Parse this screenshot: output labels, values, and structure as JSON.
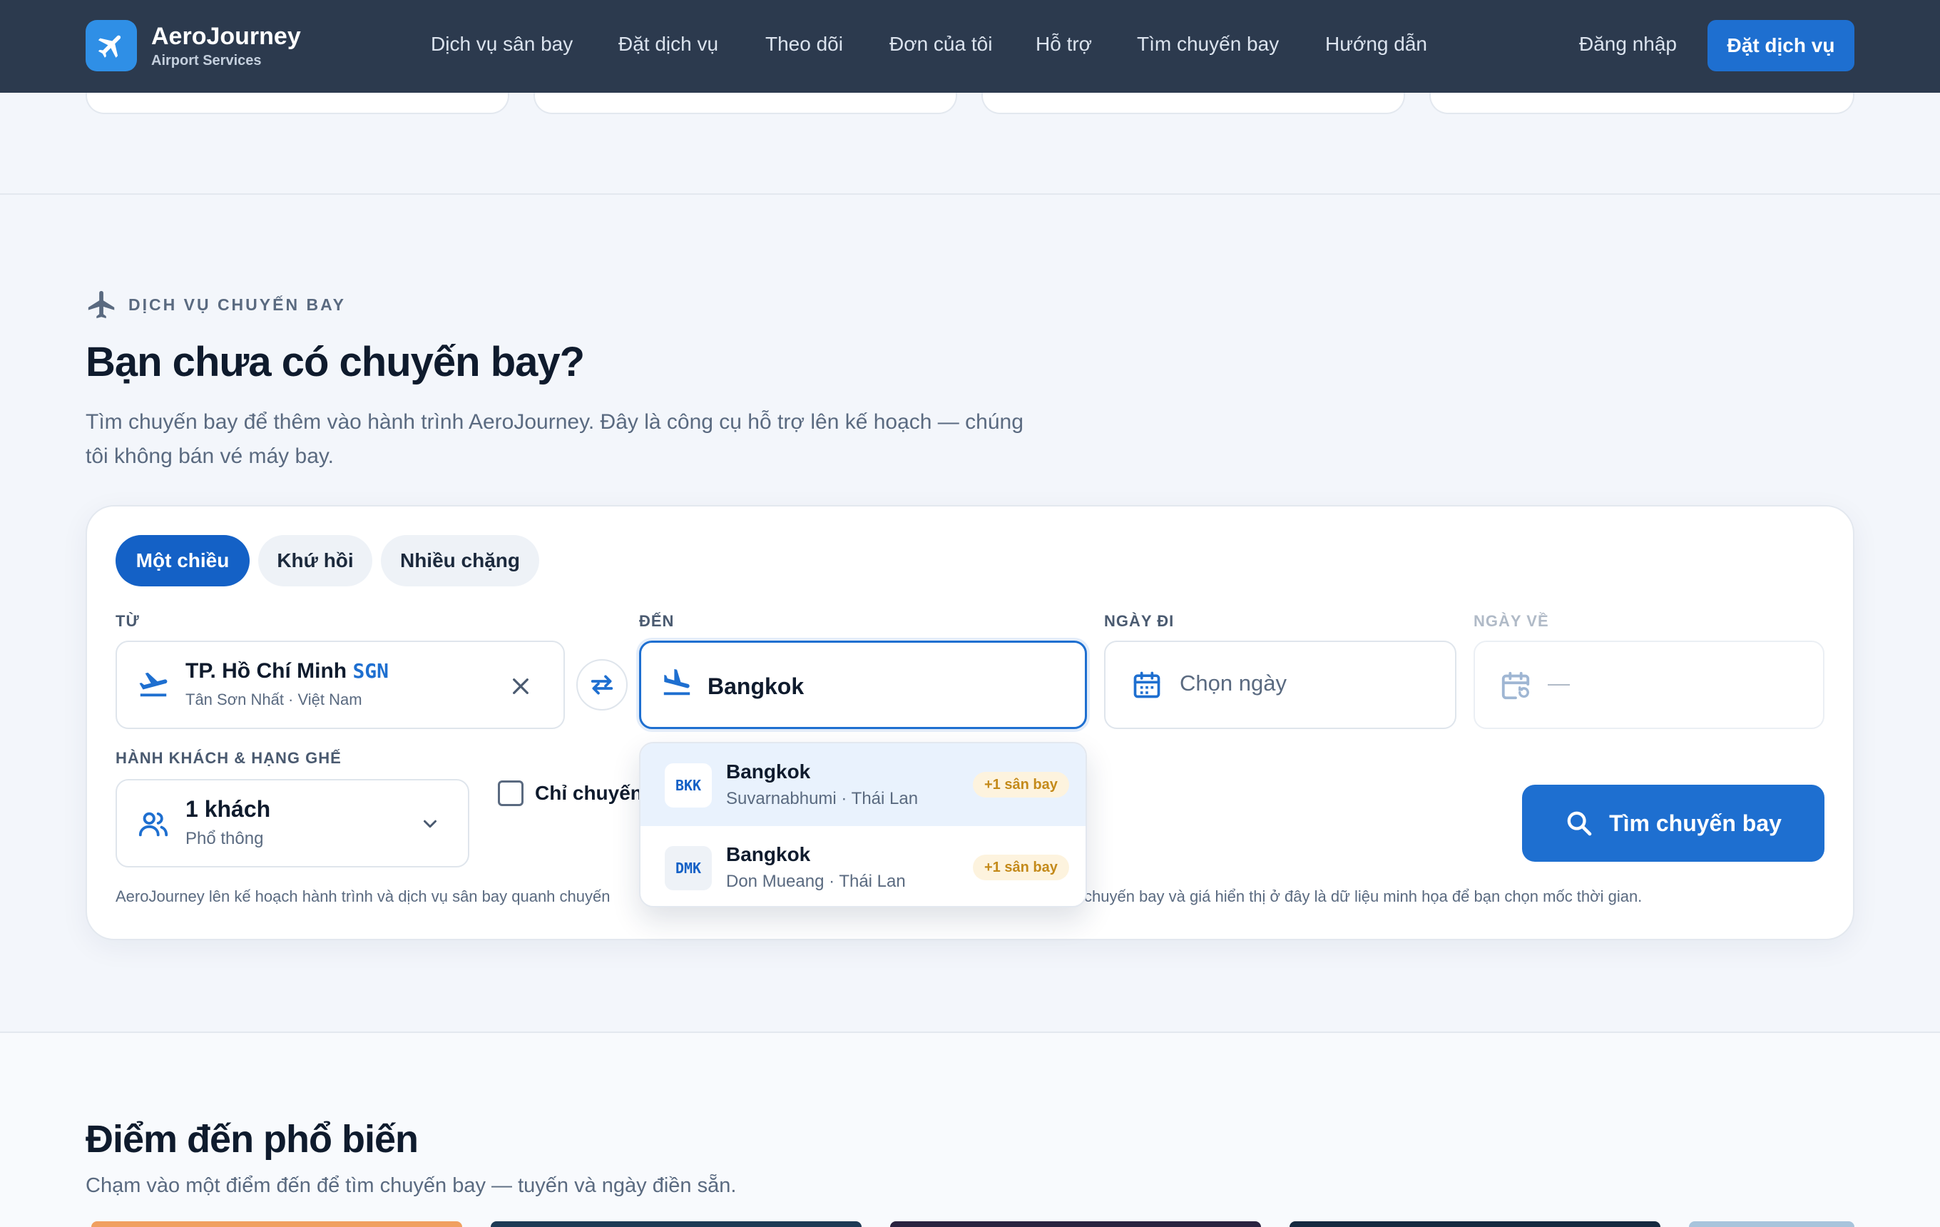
{
  "header": {
    "brand_name": "AeroJourney",
    "brand_sub": "Airport Services",
    "nav": [
      "Dịch vụ sân bay",
      "Đặt dịch vụ",
      "Theo dõi",
      "Đơn của tôi",
      "Hỗ trợ",
      "Tìm chuyến bay",
      "Hướng dẫn"
    ],
    "login": "Đăng nhập",
    "cta": "Đặt dịch vụ"
  },
  "section": {
    "eyebrow": "DỊCH VỤ CHUYẾN BAY",
    "title": "Bạn chưa có chuyến bay?",
    "description": "Tìm chuyến bay để thêm vào hành trình AeroJourney. Đây là công cụ hỗ trợ lên kế hoạch — chúng tôi không bán vé máy bay."
  },
  "search": {
    "trip_types": [
      "Một chiều",
      "Khứ hồi",
      "Nhiều chặng"
    ],
    "active_trip_type": "Một chiều",
    "labels": {
      "from": "TỪ",
      "to": "ĐẾN",
      "depart": "NGÀY ĐI",
      "return": "NGÀY VỀ",
      "passengers": "HÀNH KHÁCH & HẠNG GHẾ"
    },
    "from": {
      "city": "TP. Hồ Chí Minh",
      "code": "SGN",
      "detail": "Tân Sơn Nhất · Việt Nam"
    },
    "to_value": "Bangkok",
    "depart_placeholder": "Chọn ngày",
    "return_placeholder": "—",
    "passengers": {
      "count": "1 khách",
      "cabin": "Phổ thông"
    },
    "direct_only_label": "Chỉ chuyến",
    "search_button": "Tìm chuyến bay",
    "footnote_left": "AeroJourney lên kế hoạch hành trình và dịch vụ sân bay quanh chuyến",
    "footnote_right": "chuyến bay và giá hiển thị ở đây là dữ liệu minh họa để bạn chọn mốc thời gian."
  },
  "suggestions": [
    {
      "code": "BKK",
      "name": "Bangkok",
      "detail": "Suvarnabhumi · Thái Lan",
      "badge": "+1 sân bay"
    },
    {
      "code": "DMK",
      "name": "Bangkok",
      "detail": "Don Mueang · Thái Lan",
      "badge": "+1 sân bay"
    }
  ],
  "popular": {
    "title": "Điểm đến phổ biến",
    "description": "Chạm vào một điểm đến để tìm chuyến bay — tuyến và ngày điền sẵn."
  },
  "colors": {
    "header_bg": "#2c3a4e",
    "accent": "#1e6fd0",
    "badge_text": "#c48a1a",
    "badge_bg": "#fdf3de"
  }
}
